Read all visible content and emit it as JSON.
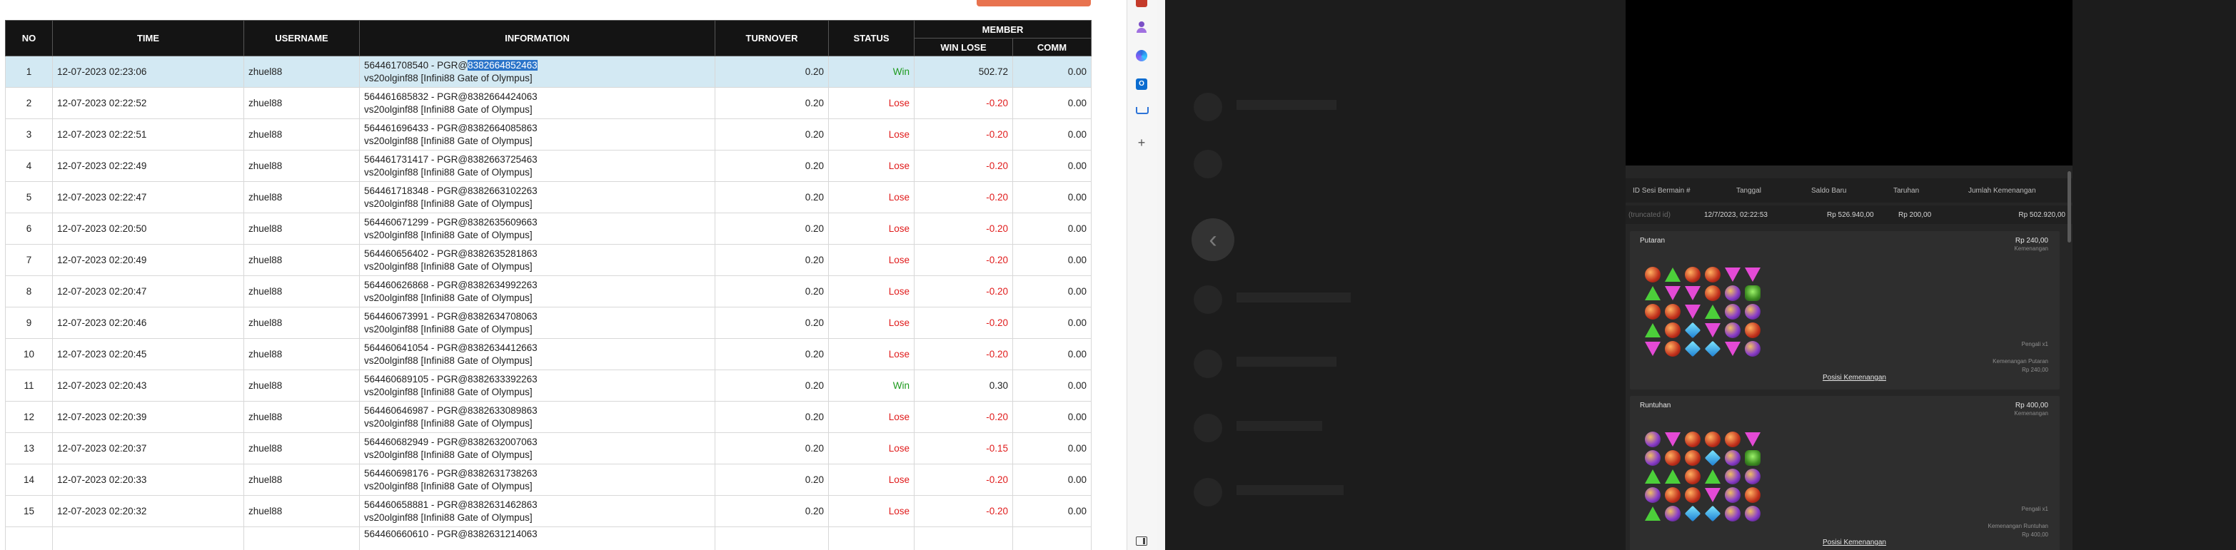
{
  "table": {
    "headers": {
      "no": "NO",
      "time": "TIME",
      "username": "USERNAME",
      "information": "INFORMATION",
      "turnover": "TURNOVER",
      "status": "STATUS",
      "member": "MEMBER",
      "win_lose": "WIN LOSE",
      "comm": "COMM"
    },
    "rows": [
      {
        "no": "1",
        "time": "12-07-2023 02:23:06",
        "username": "zhuel88",
        "info_prefix": "564461708540 - PGR@",
        "info_highlight": "8382664852463",
        "info_line2": "vs20olginf88 [Infini88 Gate of Olympus]",
        "turnover": "0.20",
        "status": "Win",
        "win_lose": "502.72",
        "comm": "0.00"
      },
      {
        "no": "2",
        "time": "12-07-2023 02:22:52",
        "username": "zhuel88",
        "info_prefix": "564461685832 - PGR@8382664424063",
        "info_highlight": "",
        "info_line2": "vs20olginf88 [Infini88 Gate of Olympus]",
        "turnover": "0.20",
        "status": "Lose",
        "win_lose": "-0.20",
        "comm": "0.00"
      },
      {
        "no": "3",
        "time": "12-07-2023 02:22:51",
        "username": "zhuel88",
        "info_prefix": "564461696433 - PGR@8382664085863",
        "info_highlight": "",
        "info_line2": "vs20olginf88 [Infini88 Gate of Olympus]",
        "turnover": "0.20",
        "status": "Lose",
        "win_lose": "-0.20",
        "comm": "0.00"
      },
      {
        "no": "4",
        "time": "12-07-2023 02:22:49",
        "username": "zhuel88",
        "info_prefix": "564461731417 - PGR@8382663725463",
        "info_highlight": "",
        "info_line2": "vs20olginf88 [Infini88 Gate of Olympus]",
        "turnover": "0.20",
        "status": "Lose",
        "win_lose": "-0.20",
        "comm": "0.00"
      },
      {
        "no": "5",
        "time": "12-07-2023 02:22:47",
        "username": "zhuel88",
        "info_prefix": "564461718348 - PGR@8382663102263",
        "info_highlight": "",
        "info_line2": "vs20olginf88 [Infini88 Gate of Olympus]",
        "turnover": "0.20",
        "status": "Lose",
        "win_lose": "-0.20",
        "comm": "0.00"
      },
      {
        "no": "6",
        "time": "12-07-2023 02:20:50",
        "username": "zhuel88",
        "info_prefix": "564460671299 - PGR@8382635609663",
        "info_highlight": "",
        "info_line2": "vs20olginf88 [Infini88 Gate of Olympus]",
        "turnover": "0.20",
        "status": "Lose",
        "win_lose": "-0.20",
        "comm": "0.00"
      },
      {
        "no": "7",
        "time": "12-07-2023 02:20:49",
        "username": "zhuel88",
        "info_prefix": "564460656402 - PGR@8382635281863",
        "info_highlight": "",
        "info_line2": "vs20olginf88 [Infini88 Gate of Olympus]",
        "turnover": "0.20",
        "status": "Lose",
        "win_lose": "-0.20",
        "comm": "0.00"
      },
      {
        "no": "8",
        "time": "12-07-2023 02:20:47",
        "username": "zhuel88",
        "info_prefix": "564460626868 - PGR@8382634992263",
        "info_highlight": "",
        "info_line2": "vs20olginf88 [Infini88 Gate of Olympus]",
        "turnover": "0.20",
        "status": "Lose",
        "win_lose": "-0.20",
        "comm": "0.00"
      },
      {
        "no": "9",
        "time": "12-07-2023 02:20:46",
        "username": "zhuel88",
        "info_prefix": "564460673991 - PGR@8382634708063",
        "info_highlight": "",
        "info_line2": "vs20olginf88 [Infini88 Gate of Olympus]",
        "turnover": "0.20",
        "status": "Lose",
        "win_lose": "-0.20",
        "comm": "0.00"
      },
      {
        "no": "10",
        "time": "12-07-2023 02:20:45",
        "username": "zhuel88",
        "info_prefix": "564460641054 - PGR@8382634412663",
        "info_highlight": "",
        "info_line2": "vs20olginf88 [Infini88 Gate of Olympus]",
        "turnover": "0.20",
        "status": "Lose",
        "win_lose": "-0.20",
        "comm": "0.00"
      },
      {
        "no": "11",
        "time": "12-07-2023 02:20:43",
        "username": "zhuel88",
        "info_prefix": "564460689105 - PGR@8382633392263",
        "info_highlight": "",
        "info_line2": "vs20olginf88 [Infini88 Gate of Olympus]",
        "turnover": "0.20",
        "status": "Win",
        "win_lose": "0.30",
        "comm": "0.00"
      },
      {
        "no": "12",
        "time": "12-07-2023 02:20:39",
        "username": "zhuel88",
        "info_prefix": "564460646987 - PGR@8382633089863",
        "info_highlight": "",
        "info_line2": "vs20olginf88 [Infini88 Gate of Olympus]",
        "turnover": "0.20",
        "status": "Lose",
        "win_lose": "-0.20",
        "comm": "0.00"
      },
      {
        "no": "13",
        "time": "12-07-2023 02:20:37",
        "username": "zhuel88",
        "info_prefix": "564460682949 - PGR@8382632007063",
        "info_highlight": "",
        "info_line2": "vs20olginf88 [Infini88 Gate of Olympus]",
        "turnover": "0.20",
        "status": "Lose",
        "win_lose": "-0.15",
        "comm": "0.00"
      },
      {
        "no": "14",
        "time": "12-07-2023 02:20:33",
        "username": "zhuel88",
        "info_prefix": "564460698176 - PGR@8382631738263",
        "info_highlight": "",
        "info_line2": "vs20olginf88 [Infini88 Gate of Olympus]",
        "turnover": "0.20",
        "status": "Lose",
        "win_lose": "-0.20",
        "comm": "0.00"
      },
      {
        "no": "15",
        "time": "12-07-2023 02:20:32",
        "username": "zhuel88",
        "info_prefix": "564460658881 - PGR@8382631462863",
        "info_highlight": "",
        "info_line2": "vs20olginf88 [Infini88 Gate of Olympus]",
        "turnover": "0.20",
        "status": "Lose",
        "win_lose": "-0.20",
        "comm": "0.00"
      }
    ],
    "partial_row_info": "564460660610 - PGR@8382631214063"
  },
  "colors": {
    "header_bg": "#141414",
    "selected_row": "#d3e9f3",
    "win": "#1c9a1c",
    "lose": "#e01b1b",
    "accent": "#e8734f",
    "dark_bg": "#1c1c1c"
  },
  "sidebar_icons": [
    "app-icon-red",
    "person-icon",
    "copilot-icon",
    "outlook-icon",
    "shopping-cart-icon",
    "add-icon",
    "sidebar-toggle-icon"
  ],
  "history_panel": {
    "columns": [
      "ID Sesi Bermain #",
      "Tanggal",
      "Saldo Baru",
      "Taruhan",
      "Jumlah Kemenangan"
    ],
    "row": [
      "(truncated id)",
      "12/7/2023, 02:22:53",
      "Rp 526.940,00",
      "Rp 200,00",
      "Rp 502.920,00"
    ],
    "cards": [
      {
        "title": "Putaran",
        "amount": "Rp 240,00",
        "sub": "Kemenangan",
        "small1": "Pengali x1",
        "small2": "Kemenangan Putaran",
        "small3": "Rp 240,00",
        "link": "Posisi Kemenangan"
      },
      {
        "title": "Runtuhan",
        "amount": "Rp 400,00",
        "sub": "Kemenangan",
        "small1": "Pengali x1",
        "small2": "Kemenangan Runtuhan",
        "small3": "Rp 400,00",
        "link": "Posisi Kemenangan"
      }
    ]
  }
}
